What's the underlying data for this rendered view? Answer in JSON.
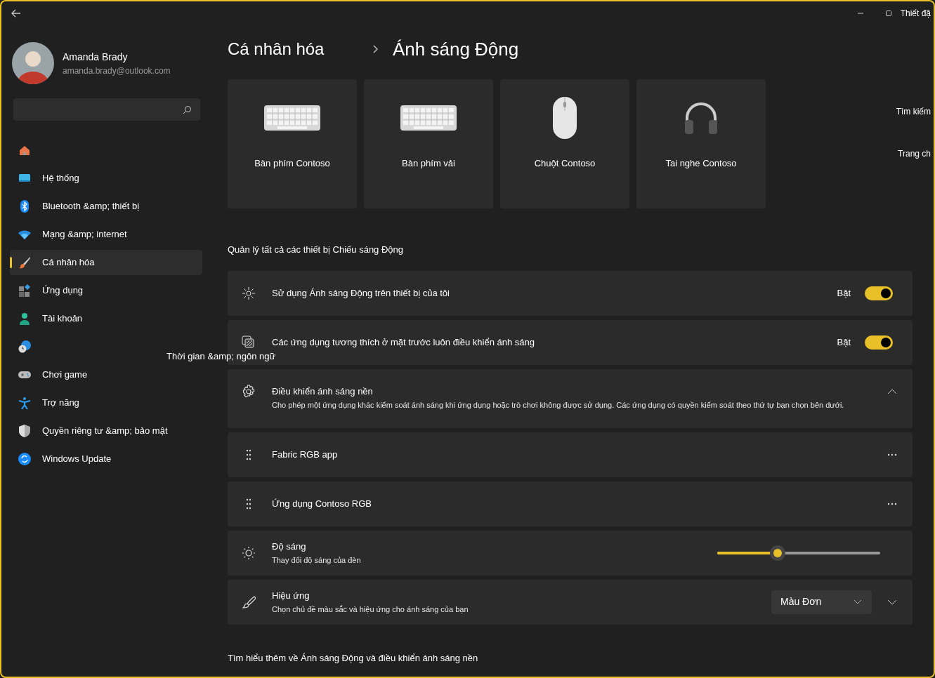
{
  "window": {
    "title": "Thiết đặ",
    "floating_labels": [
      "Tìm kiếm",
      "Trang ch"
    ]
  },
  "user": {
    "name": "Amanda Brady",
    "email": "amanda.brady@outlook.com"
  },
  "nav": [
    {
      "selected": false
    },
    {
      "label": "Hệ thống",
      "selected": false
    },
    {
      "label": "Bluetooth &amp; thiết bị",
      "selected": false
    },
    {
      "label": "Mạng &amp; internet",
      "selected": false
    },
    {
      "label": "Cá nhân hóa",
      "selected": true
    },
    {
      "label": "Ứng dụng",
      "selected": false
    },
    {
      "label": "Tài khoản",
      "selected": false
    },
    {
      "label": "Thời gian &amp; ngôn ngữ",
      "selected": false
    },
    {
      "label": "Chơi game",
      "selected": false
    },
    {
      "label": "Trợ năng",
      "selected": false
    },
    {
      "label": "Quyền riêng tư &amp; bảo mật",
      "selected": false
    },
    {
      "label": "Windows Update",
      "selected": false
    }
  ],
  "breadcrumb": [
    "Cá nhân hóa",
    "Ánh sáng Động"
  ],
  "devices": [
    {
      "kind": "keyboard",
      "label": "Bàn phím Contoso"
    },
    {
      "kind": "keyboard",
      "label": "Bàn phím vải"
    },
    {
      "kind": "mouse",
      "label": "Chuột Contoso"
    },
    {
      "kind": "headphones",
      "label": "Tai nghe Contoso"
    }
  ],
  "section_title": "Quản lý tất cả các thiết bị Chiếu sáng Động",
  "rows": [
    {
      "kind": "toggle",
      "title": "Sử dụng Ánh sáng Động trên thiết bị của tôi",
      "state_label": "Bật",
      "on": true
    },
    {
      "kind": "toggle",
      "title": "Các ứng dụng tương thích ở mặt trước luôn điều khiển ánh sáng",
      "state_label": "Bật",
      "on": true
    },
    {
      "kind": "expander",
      "title": "Điều khiển ánh sáng nền",
      "description": "Cho phép một ứng dụng khác kiểm soát ánh sáng khi ứng dụng hoặc trò chơi không được sử dụng. Các ứng dụng có quyền kiểm soát theo thứ tự bạn chọn bên dưới.",
      "expanded": true
    },
    {
      "kind": "app",
      "title": "Fabric RGB app"
    },
    {
      "kind": "app",
      "title": "Ứng dụng Contoso RGB"
    },
    {
      "kind": "slider",
      "title": "Độ sáng",
      "description": "Thay đổi độ sáng của đèn",
      "level": 0.37
    },
    {
      "kind": "dropdown",
      "title": "Hiệu ứng",
      "description": "Chọn chủ đề màu sắc và hiệu ứng cho ánh sáng của bạn",
      "value": "Màu Đơn",
      "expanded": false
    }
  ],
  "footer_link": "Tìm hiểu thêm về Ánh sáng Động và điều khiển ánh sáng nền"
}
